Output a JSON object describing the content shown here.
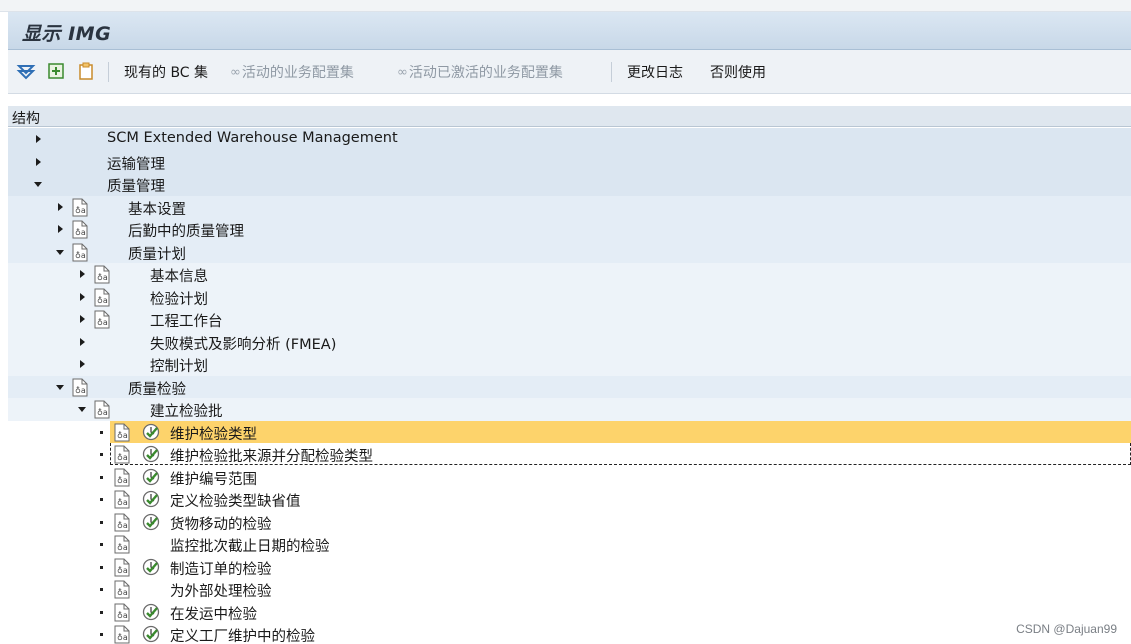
{
  "window": {
    "title": "显示 IMG"
  },
  "toolbar": {
    "existing_bc_sets": "现有的 BC 集",
    "active_bc_sets": "活动的业务配置集",
    "activated_bc_sets": "活动已激活的业务配置集",
    "change_log": "更改日志",
    "usage": "否则使用"
  },
  "structure": {
    "header": "结构",
    "rows": [
      {
        "label": "SCM Extended Warehouse Management",
        "expander": "right"
      },
      {
        "label": "运输管理",
        "expander": "right"
      },
      {
        "label": "质量管理",
        "expander": "down"
      },
      {
        "label": "基本设置",
        "expander": "right",
        "doc_icon": true
      },
      {
        "label": "后勤中的质量管理",
        "expander": "right",
        "doc_icon": true
      },
      {
        "label": "质量计划",
        "expander": "down",
        "doc_icon": true
      },
      {
        "label": "基本信息",
        "expander": "right",
        "doc_icon": true
      },
      {
        "label": "检验计划",
        "expander": "right",
        "doc_icon": true
      },
      {
        "label": "工程工作台",
        "expander": "right",
        "doc_icon": true
      },
      {
        "label": "失败模式及影响分析 (FMEA)",
        "expander": "right",
        "doc_icon": false
      },
      {
        "label": "控制计划",
        "expander": "right",
        "doc_icon": false
      },
      {
        "label": "质量检验",
        "expander": "down",
        "doc_icon": true
      },
      {
        "label": "建立检验批",
        "expander": "down",
        "doc_icon": true
      },
      {
        "label": "维护检验类型",
        "expander": "dot",
        "doc_icon": true,
        "exec_icon": true,
        "selected": true
      },
      {
        "label": "维护检验批来源并分配检验类型",
        "expander": "dot",
        "doc_icon": true,
        "exec_icon": true,
        "focus": true
      },
      {
        "label": "维护编号范围",
        "expander": "dot",
        "doc_icon": true,
        "exec_icon": true
      },
      {
        "label": "定义检验类型缺省值",
        "expander": "dot",
        "doc_icon": true,
        "exec_icon": true
      },
      {
        "label": "货物移动的检验",
        "expander": "dot",
        "doc_icon": true,
        "exec_icon": true
      },
      {
        "label": "监控批次截止日期的检验",
        "expander": "dot",
        "doc_icon": true,
        "exec_icon": false
      },
      {
        "label": "制造订单的检验",
        "expander": "dot",
        "doc_icon": true,
        "exec_icon": true
      },
      {
        "label": "为外部处理检验",
        "expander": "dot",
        "doc_icon": true,
        "exec_icon": false
      },
      {
        "label": "在发运中检验",
        "expander": "dot",
        "doc_icon": true,
        "exec_icon": true
      },
      {
        "label": "定义工厂维护中的检验",
        "expander": "dot",
        "doc_icon": true,
        "exec_icon": true
      }
    ]
  },
  "watermark": "CSDN @Dajuan99",
  "colors": {
    "level0_bg": "#dbe6f1",
    "level1_bg": "#e4edf6",
    "level2_bg": "#edf3f9",
    "selected_bg": "#fdd36b",
    "accent": "#2f6fb5",
    "exec_icon_green": "#3a8a2e"
  }
}
